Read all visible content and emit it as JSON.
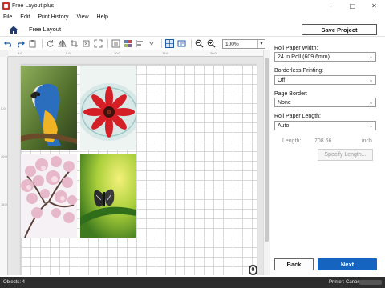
{
  "window": {
    "title": "Free Layout plus"
  },
  "menu": [
    "File",
    "Edit",
    "Print History",
    "View",
    "Help"
  ],
  "header": {
    "layout_label": "Free Layout",
    "save_label": "Save Project"
  },
  "toolbar": {
    "zoom": "100%"
  },
  "ruler": {
    "h_ticks": [
      "0.0",
      "5.0",
      "10.0",
      "15.0",
      "20.0"
    ],
    "v_ticks": [
      "5.0",
      "10.0",
      "15.0"
    ]
  },
  "canvas": {
    "page_number": "0"
  },
  "settings": {
    "roll_width": {
      "label": "Roll Paper Width:",
      "value": "24 in Roll (609.6mm)"
    },
    "borderless": {
      "label": "Borderless Printing:",
      "value": "Off"
    },
    "page_border": {
      "label": "Page Border:",
      "value": "None"
    },
    "roll_length": {
      "label": "Roll Paper Length:",
      "value": "Auto"
    },
    "length": {
      "label": "Length:",
      "value": "708.66",
      "unit": "inch"
    },
    "specify_label": "Specify Length..."
  },
  "nav": {
    "back_label": "Back",
    "next_label": "Next"
  },
  "status": {
    "objects": "Objects: 4",
    "printer": "Printer: Canon"
  },
  "colors": {
    "accent": "#1565c0",
    "status_bg": "#2d2d2d"
  }
}
